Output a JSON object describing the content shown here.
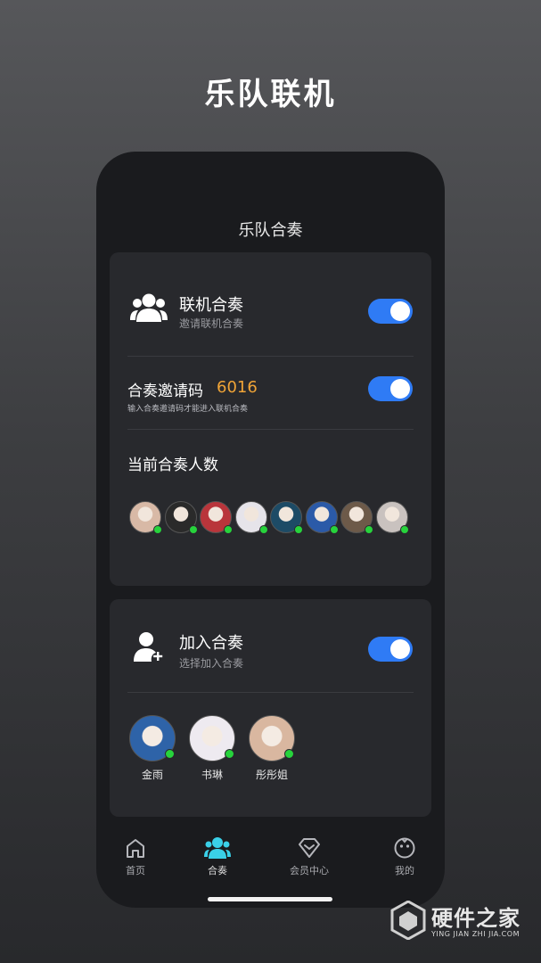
{
  "promo": {
    "title": "乐队联机"
  },
  "screen": {
    "title": "乐队合奏"
  },
  "online_play": {
    "icon": "users-group-icon",
    "title": "联机合奏",
    "subtitle": "邀请联机合奏",
    "toggle_on": true
  },
  "invite_code": {
    "label": "合奏邀请码",
    "code": "6016",
    "hint": "输入合奏邀请码才能进入联机合奏",
    "toggle_on": true
  },
  "current_players": {
    "label": "当前合奏人数",
    "avatars": [
      {
        "name": "avatar-1",
        "color": "#d8b9a6",
        "online": true
      },
      {
        "name": "avatar-2",
        "color": "#2a2a2a",
        "online": true
      },
      {
        "name": "avatar-3",
        "color": "#b9353b",
        "online": true
      },
      {
        "name": "avatar-4",
        "color": "#e6e4ea",
        "online": true
      },
      {
        "name": "avatar-5",
        "color": "#1d4b66",
        "online": true
      },
      {
        "name": "avatar-6",
        "color": "#2b5aa8",
        "online": true
      },
      {
        "name": "avatar-7",
        "color": "#6d5a49",
        "online": true
      },
      {
        "name": "avatar-8",
        "color": "#c9c2bf",
        "online": true
      }
    ]
  },
  "join_play": {
    "icon": "add-user-icon",
    "title": "加入合奏",
    "subtitle": "选择加入合奏",
    "toggle_on": true,
    "members": [
      {
        "name": "金雨",
        "color": "#2e63a8",
        "online": true
      },
      {
        "name": "书琳",
        "color": "#eeeaf0",
        "online": true
      },
      {
        "name": "彤彤姐",
        "color": "#d9b7a0",
        "online": true
      }
    ]
  },
  "tabbar": {
    "tabs": [
      {
        "label": "首页",
        "icon": "home-icon",
        "active": false
      },
      {
        "label": "合奏",
        "icon": "users-icon",
        "active": true
      },
      {
        "label": "会员中心",
        "icon": "vip-diamond-icon",
        "active": false
      },
      {
        "label": "我的",
        "icon": "profile-face-icon",
        "active": false
      }
    ]
  },
  "watermark": {
    "title": "硬件之家",
    "subtitle": "YING JIAN ZHI JIA.COM"
  },
  "colors": {
    "accent": "#2f7bf5",
    "active_tab": "#3ad0e8",
    "code": "#f0a437",
    "online": "#27d33c"
  }
}
